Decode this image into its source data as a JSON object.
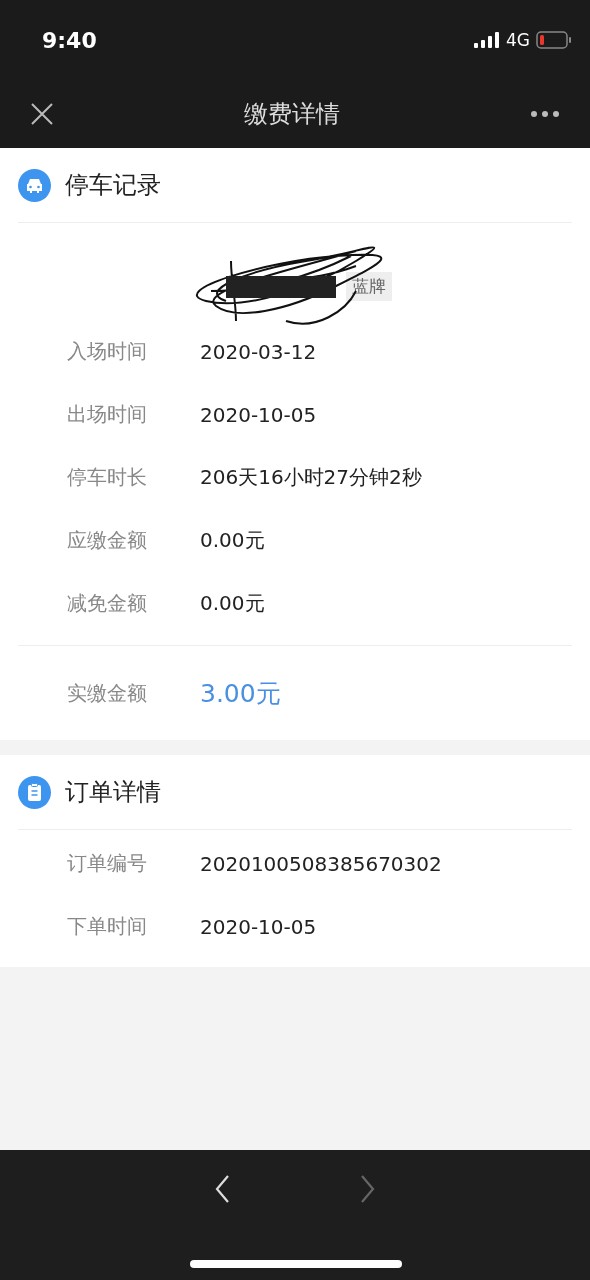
{
  "status_bar": {
    "time": "9:40",
    "network": "4G"
  },
  "nav_bar": {
    "title": "缴费详情"
  },
  "parking_record": {
    "title": "停车记录",
    "plate_tag": "蓝牌",
    "rows": [
      {
        "label": "入场时间",
        "value": "2020-03-12",
        "kind": "normal"
      },
      {
        "label": "出场时间",
        "value": "2020-10-05",
        "kind": "normal"
      },
      {
        "label": "停车时长",
        "value": "206天16小时27分钟2秒",
        "kind": "normal"
      },
      {
        "label": "应缴金额",
        "value": "0.00元",
        "kind": "normal"
      },
      {
        "label": "减免金额",
        "value": "0.00元",
        "kind": "normal"
      },
      {
        "label": "实缴金额",
        "value": "3.00元",
        "kind": "total"
      }
    ]
  },
  "order_details": {
    "title": "订单详情",
    "rows": [
      {
        "label": "订单编号",
        "value": "2020100508385670302",
        "kind": "normal"
      },
      {
        "label": "下单时间",
        "value": "2020-10-05",
        "kind": "normal"
      }
    ]
  },
  "browser_toolbar": {
    "back": {
      "disabled": false
    },
    "forward": {
      "disabled": true
    }
  }
}
